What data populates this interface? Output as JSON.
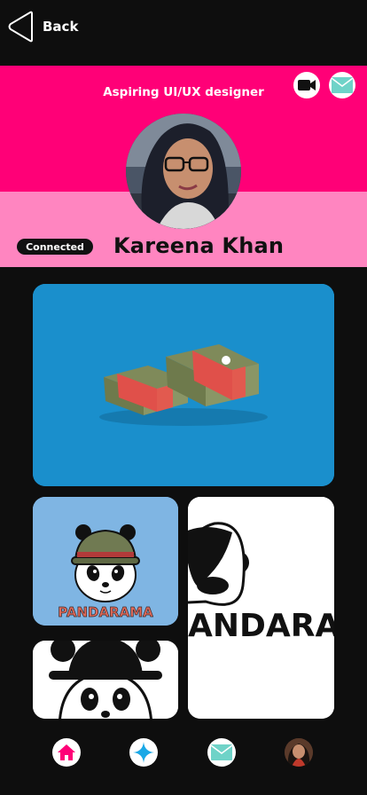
{
  "header": {
    "back_label": "Back"
  },
  "profile": {
    "tagline": "Aspiring UI/UX designer",
    "name": "Kareena Khan",
    "status_badge": "Connected",
    "colors": {
      "header_top": "#ff0077",
      "header_bottom": "#ff85c0"
    }
  },
  "actions": {
    "video_icon": "video-camera-icon",
    "mail_icon": "mail-icon"
  },
  "gallery": {
    "brand_text": "PANDARAMA",
    "wide_brand_text": "ANDARAM"
  },
  "nav": {
    "items": [
      "home-icon",
      "explore-star-icon",
      "mail-icon",
      "profile-avatar"
    ],
    "accent": "#ff0077"
  }
}
